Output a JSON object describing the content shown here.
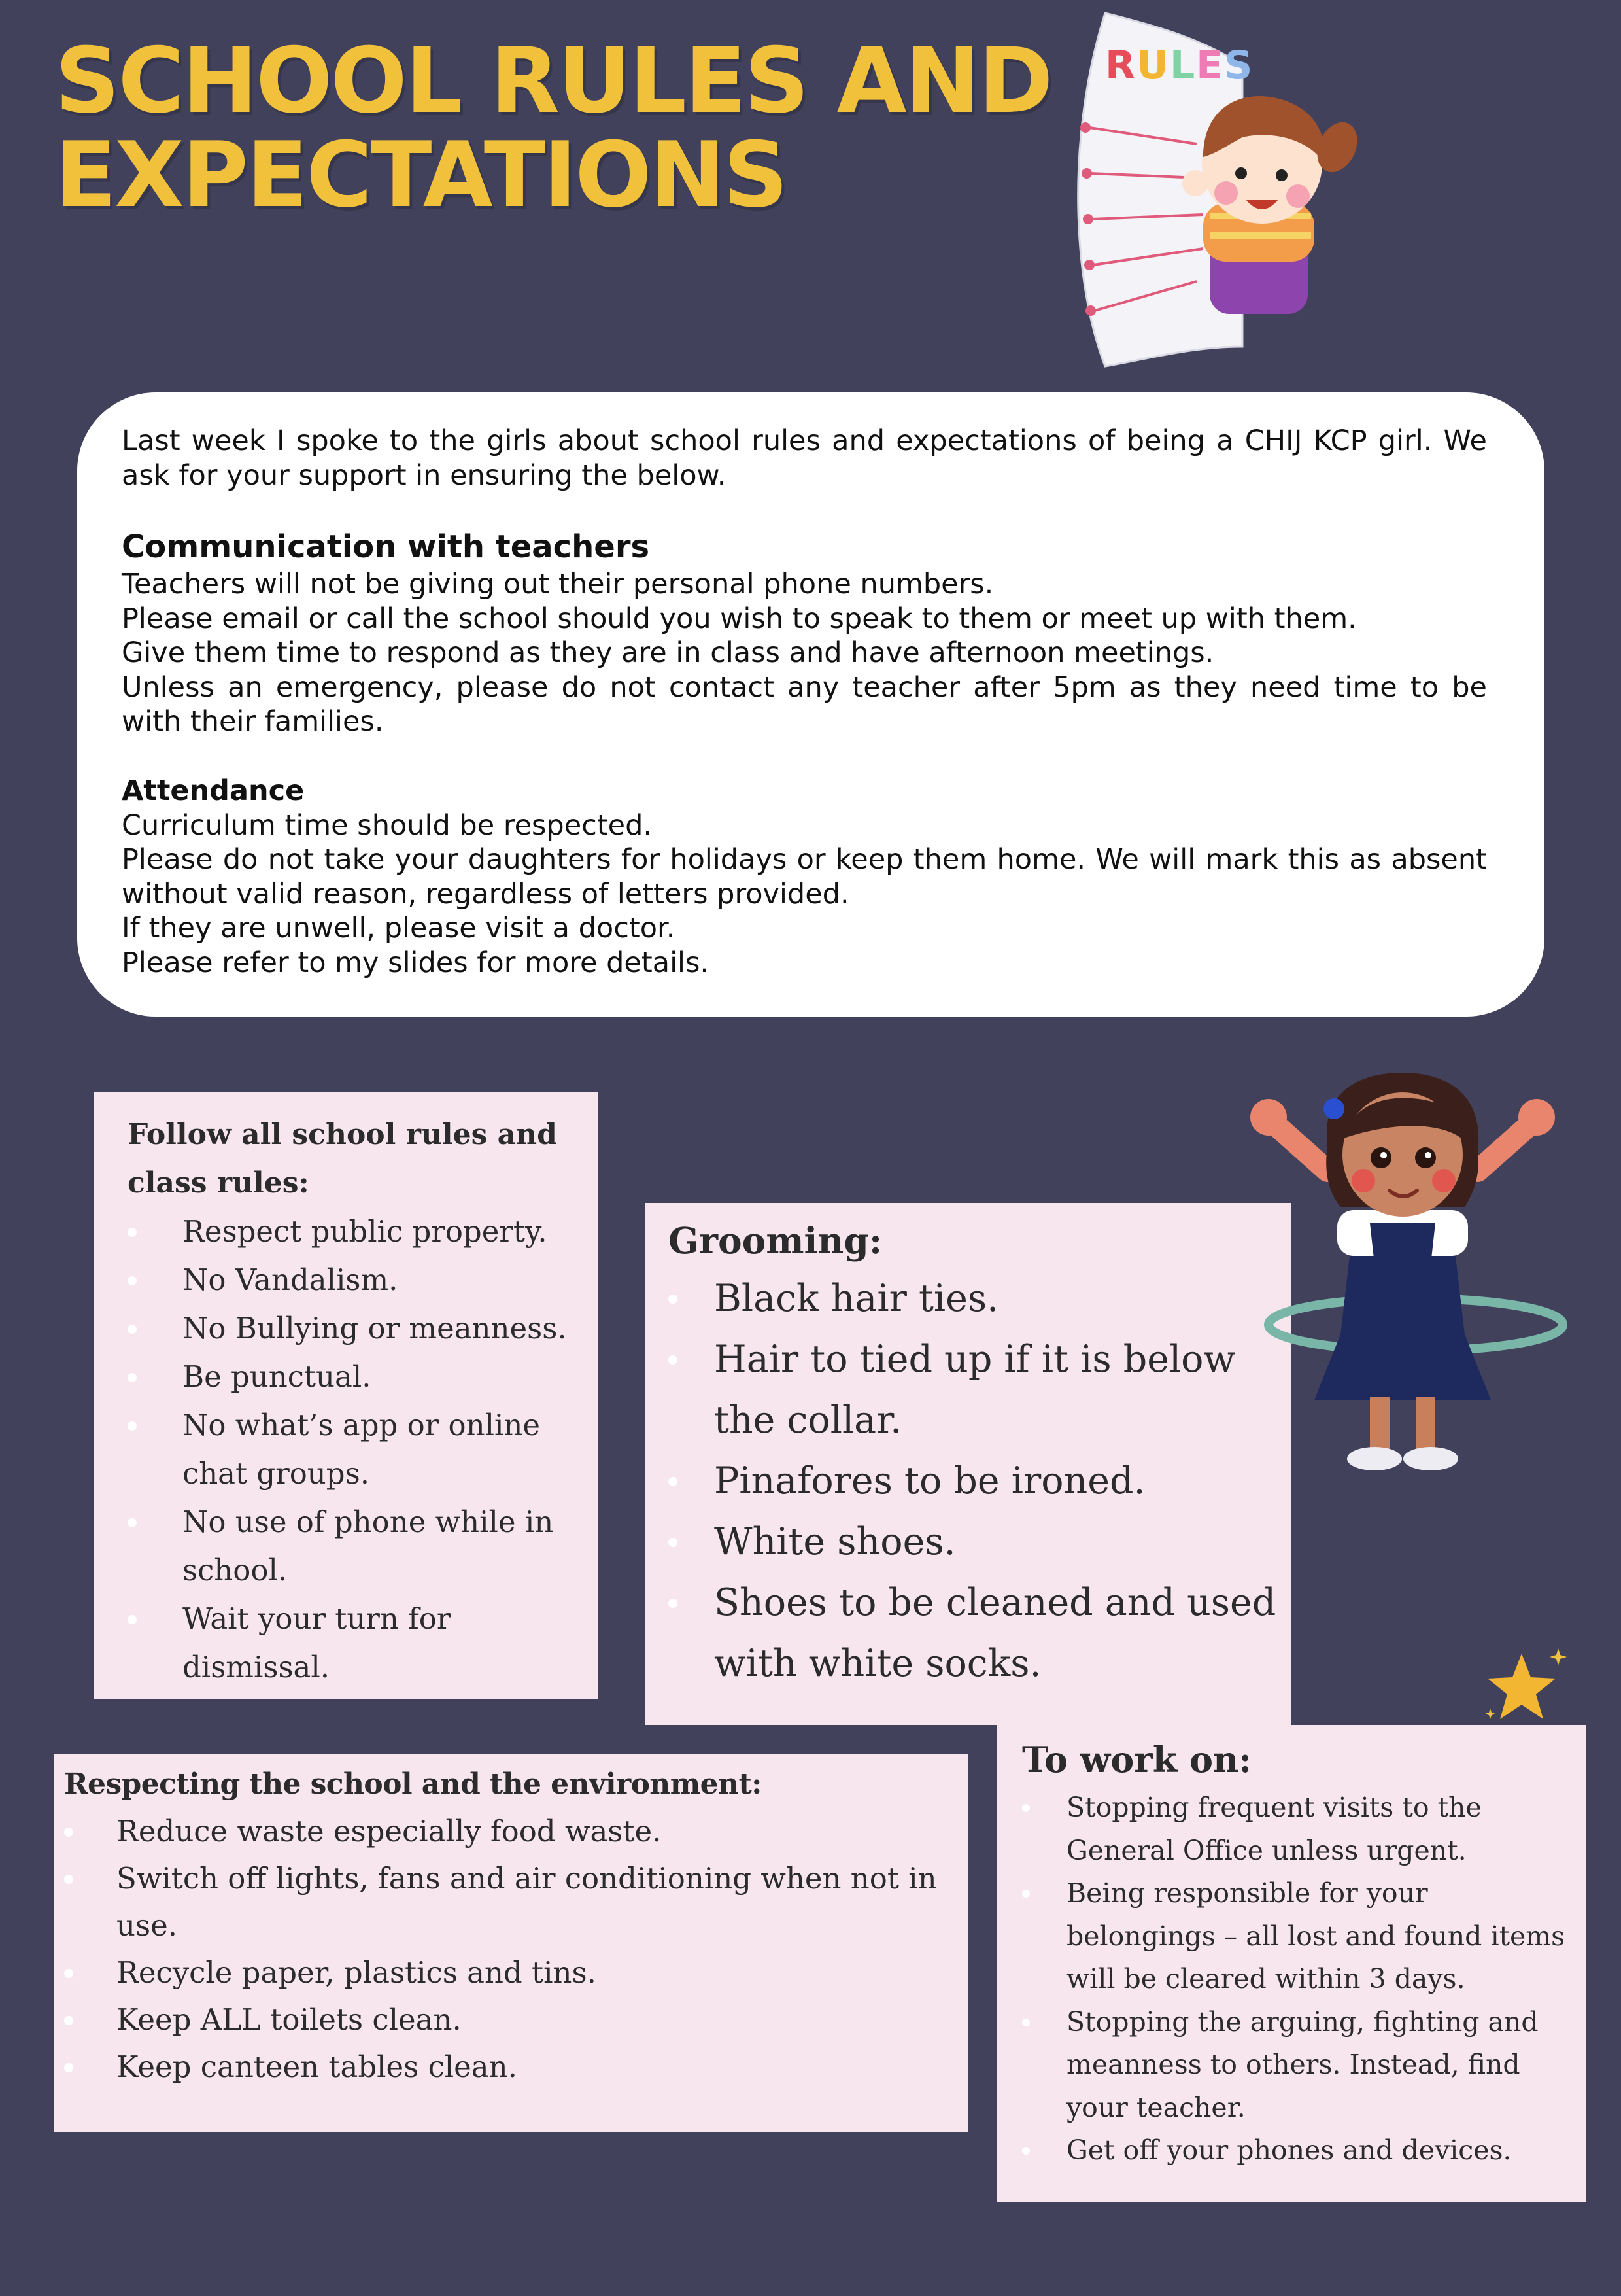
{
  "header": {
    "title_line1": "SCHOOL RULES AND",
    "title_line2": "EXPECTATIONS",
    "rules_badge_text": "RULES",
    "accent_color": "#f2c13b",
    "background_color": "#41415c"
  },
  "intro": {
    "opening": "Last week I spoke to the girls about school rules and expectations of being a CHIJ KCP girl. We ask for your support in ensuring the below.",
    "communication": {
      "heading": "Communication with teachers",
      "lines": [
        "Teachers will not be giving out their personal phone numbers.",
        "Please email or call the school should you wish to speak to them or meet up with them.",
        "Give them time to respond as they are in class and have afternoon meetings.",
        "Unless an emergency, please do not contact any teacher after 5pm as they need time to be with their families."
      ]
    },
    "attendance": {
      "heading": "Attendance",
      "lines": [
        "Curriculum time should be respected.",
        "Please do not take your daughters for holidays or keep them home. We will mark this as absent without valid reason, regardless of letters provided.",
        "If they are unwell, please visit a doctor.",
        "Please refer to my slides for more details."
      ]
    }
  },
  "rules_card": {
    "heading": "Follow all school rules and class rules:",
    "items": [
      "Respect public property.",
      "No Vandalism.",
      "No Bullying or meanness.",
      "Be punctual.",
      "No what’s app or online chat groups.",
      "No use of phone while in school.",
      "Wait your turn for dismissal."
    ]
  },
  "grooming_card": {
    "heading": "Grooming:",
    "items": [
      "Black hair ties.",
      "Hair to tied up if it is below the collar.",
      "Pinafores to be ironed.",
      "White shoes.",
      "Shoes to be cleaned and used with white socks."
    ]
  },
  "environment_card": {
    "heading": "Respecting the school and the environment:",
    "items": [
      "Reduce waste especially food waste.",
      "Switch off lights, fans and air  conditioning when not in use.",
      "Recycle paper, plastics and tins.",
      "Keep ALL toilets clean.",
      "Keep canteen tables clean."
    ]
  },
  "work_card": {
    "heading": "To work on:",
    "items": [
      "Stopping frequent visits to the General Office unless urgent.",
      "Being responsible for your belongings – all lost and found items will be cleared within 3 days.",
      "Stopping the arguing, fighting and meanness to others. Instead, find your teacher.",
      "Get off your phones and devices."
    ]
  }
}
